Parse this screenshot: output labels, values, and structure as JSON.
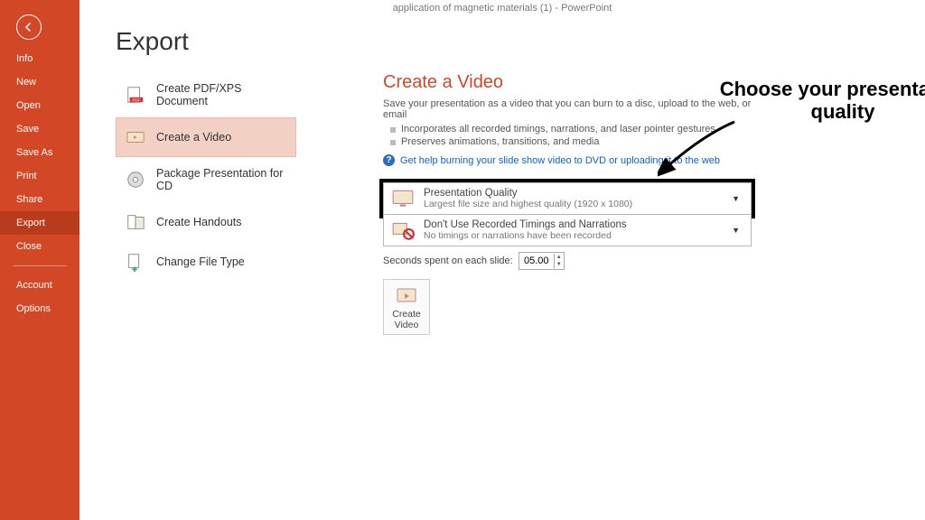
{
  "titlebar": "application of magnetic materials (1) - PowerPoint",
  "sidebar": {
    "items": [
      {
        "label": "Info"
      },
      {
        "label": "New"
      },
      {
        "label": "Open"
      },
      {
        "label": "Save"
      },
      {
        "label": "Save As"
      },
      {
        "label": "Print"
      },
      {
        "label": "Share"
      },
      {
        "label": "Export",
        "selected": true
      },
      {
        "label": "Close"
      }
    ],
    "footer": [
      {
        "label": "Account"
      },
      {
        "label": "Options"
      }
    ]
  },
  "page_title": "Export",
  "export_options": [
    {
      "label": "Create PDF/XPS Document",
      "icon": "pdf"
    },
    {
      "label": "Create a Video",
      "icon": "video",
      "selected": true
    },
    {
      "label": "Package Presentation for CD",
      "icon": "cd"
    },
    {
      "label": "Create Handouts",
      "icon": "handouts"
    },
    {
      "label": "Change File Type",
      "icon": "changefile"
    }
  ],
  "center": {
    "heading": "Create a Video",
    "desc": "Save your presentation as a video that you can burn to a disc, upload to the web, or email",
    "bullets": [
      "Incorporates all recorded timings, narrations, and laser pointer gestures",
      "Preserves animations, transitions, and media"
    ],
    "help_link": "Get help burning your slide show video to DVD or uploading it to the web",
    "quality": {
      "title": "Presentation Quality",
      "sub": "Largest file size and highest quality (1920 x 1080)"
    },
    "timings": {
      "title": "Don't Use Recorded Timings and Narrations",
      "sub": "No timings or narrations have been recorded"
    },
    "seconds_label": "Seconds spent on each slide:",
    "seconds_value": "05.00",
    "create_button": "Create Video"
  },
  "annotation": "Choose your presentation quality"
}
